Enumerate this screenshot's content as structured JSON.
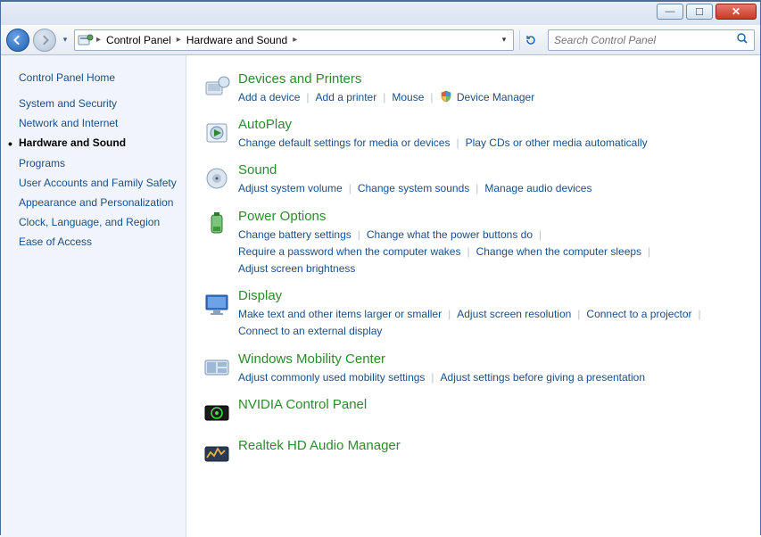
{
  "breadcrumb": {
    "item1": "Control Panel",
    "item2": "Hardware and Sound"
  },
  "search": {
    "placeholder": "Search Control Panel"
  },
  "sidebar": {
    "home": "Control Panel Home",
    "items": [
      "System and Security",
      "Network and Internet",
      "Hardware and Sound",
      "Programs",
      "User Accounts and Family Safety",
      "Appearance and Personalization",
      "Clock, Language, and Region",
      "Ease of Access"
    ],
    "active_index": 2
  },
  "categories": [
    {
      "title": "Devices and Printers",
      "links": [
        "Add a device",
        "Add a printer",
        "Mouse",
        "Device Manager"
      ],
      "shield_link_index": 3
    },
    {
      "title": "AutoPlay",
      "links": [
        "Change default settings for media or devices",
        "Play CDs or other media automatically"
      ]
    },
    {
      "title": "Sound",
      "links": [
        "Adjust system volume",
        "Change system sounds",
        "Manage audio devices"
      ]
    },
    {
      "title": "Power Options",
      "links": [
        "Change battery settings",
        "Change what the power buttons do",
        "Require a password when the computer wakes",
        "Change when the computer sleeps",
        "Adjust screen brightness"
      ]
    },
    {
      "title": "Display",
      "links": [
        "Make text and other items larger or smaller",
        "Adjust screen resolution",
        "Connect to a projector",
        "Connect to an external display"
      ]
    },
    {
      "title": "Windows Mobility Center",
      "links": [
        "Adjust commonly used mobility settings",
        "Adjust settings before giving a presentation"
      ]
    },
    {
      "title": "NVIDIA Control Panel",
      "links": []
    },
    {
      "title": "Realtek HD Audio Manager",
      "links": []
    }
  ]
}
